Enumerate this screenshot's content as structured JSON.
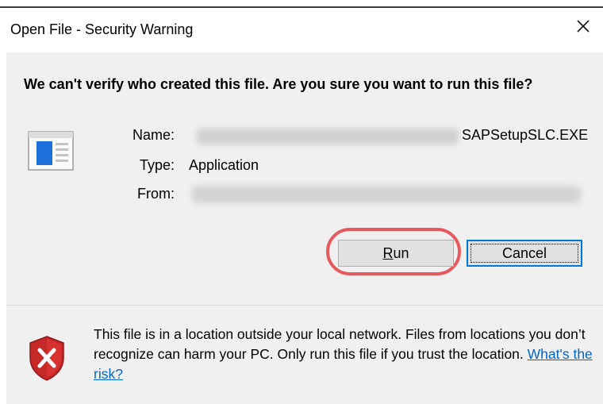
{
  "window": {
    "title": "Open File - Security Warning"
  },
  "dialog": {
    "heading": "We can't verify who created this file. Are you sure you want to run this file?",
    "name_label": "Name:",
    "name_value": "SAPSetupSLC.EXE",
    "type_label": "Type:",
    "type_value": "Application",
    "from_label": "From:",
    "from_value": ""
  },
  "buttons": {
    "run_prefix": "",
    "run_underlined": "R",
    "run_rest": "un",
    "cancel": "Cancel"
  },
  "warning": {
    "text": "This file is in a location outside your local network. Files from locations you don’t recognize can harm your PC. Only run this file if you trust the location.",
    "link": "What's the risk?"
  },
  "colors": {
    "accent": "#0078d7",
    "highlight": "#e8595e",
    "link": "#0066cc",
    "shield_red": "#c62828"
  },
  "icons": {
    "close": "close-icon",
    "app": "application-icon",
    "shield": "shield-error-icon"
  }
}
